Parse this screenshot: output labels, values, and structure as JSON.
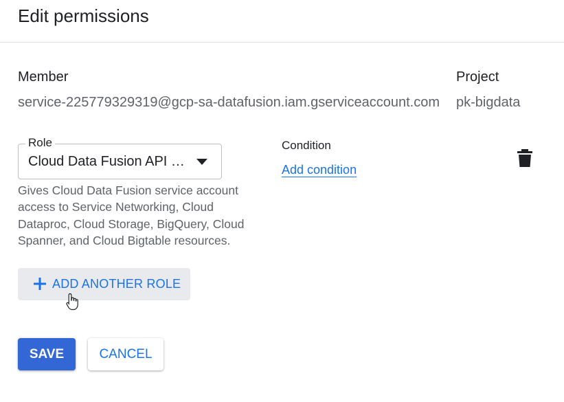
{
  "dialog": {
    "title": "Edit permissions"
  },
  "member": {
    "label": "Member",
    "value": "service-225779329319@gcp-sa-datafusion.iam.gserviceaccount.com"
  },
  "project": {
    "label": "Project",
    "value": "pk-bigdata"
  },
  "role": {
    "label": "Role",
    "selected": "Cloud Data Fusion API Se...",
    "description": "Gives Cloud Data Fusion service account access to Service Networking, Cloud Dataproc, Cloud Storage, BigQuery, Cloud Spanner, and Cloud Bigtable resources."
  },
  "condition": {
    "label": "Condition",
    "add_link": "Add condition"
  },
  "actions": {
    "add_role": "ADD ANOTHER ROLE",
    "save": "SAVE",
    "cancel": "CANCEL"
  },
  "colors": {
    "accent": "#1a73e8",
    "primary_button": "#3367d6",
    "secondary_text": "#5f6368"
  },
  "icons": {
    "delete": "trash-icon",
    "add": "plus-icon",
    "dropdown": "triangle-down-icon",
    "pointer": "hand-cursor-icon"
  }
}
